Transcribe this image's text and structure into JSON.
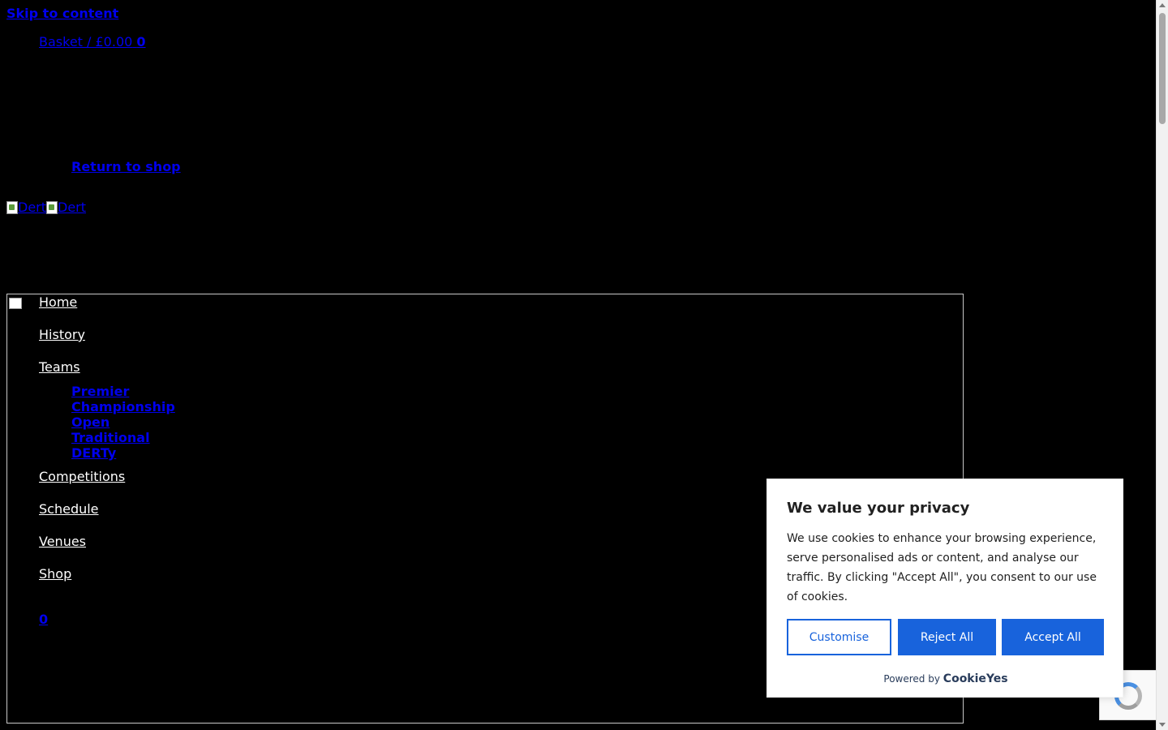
{
  "header": {
    "skip_link": "Skip to content",
    "basket_label": "Basket / £0.00",
    "basket_count": "0",
    "return_link": "Return to shop",
    "logo_alt_1": "Dert",
    "logo_alt_2": "Dert"
  },
  "nav": {
    "items": [
      "Home",
      "History",
      "Teams"
    ],
    "teams_sub": [
      "Premier",
      "Championship",
      "Open",
      "Traditional",
      "DERTy"
    ],
    "items_after": [
      "Competitions",
      "Schedule",
      "Venues",
      "Shop"
    ],
    "cart_count": "0"
  },
  "cookie_banner": {
    "title": "We value your privacy",
    "body": "We use cookies to enhance your browsing experience, serve personalised ads or content, and analyse our traffic. By clicking \"Accept All\", you consent to our use of cookies.",
    "customise_label": "Customise",
    "reject_label": "Reject All",
    "accept_label": "Accept All",
    "powered_by": "Powered by",
    "brand": "CookieYes"
  },
  "colors": {
    "page_bg": "#000000",
    "link": "#0000ee",
    "cookie_primary": "#1863dc"
  }
}
